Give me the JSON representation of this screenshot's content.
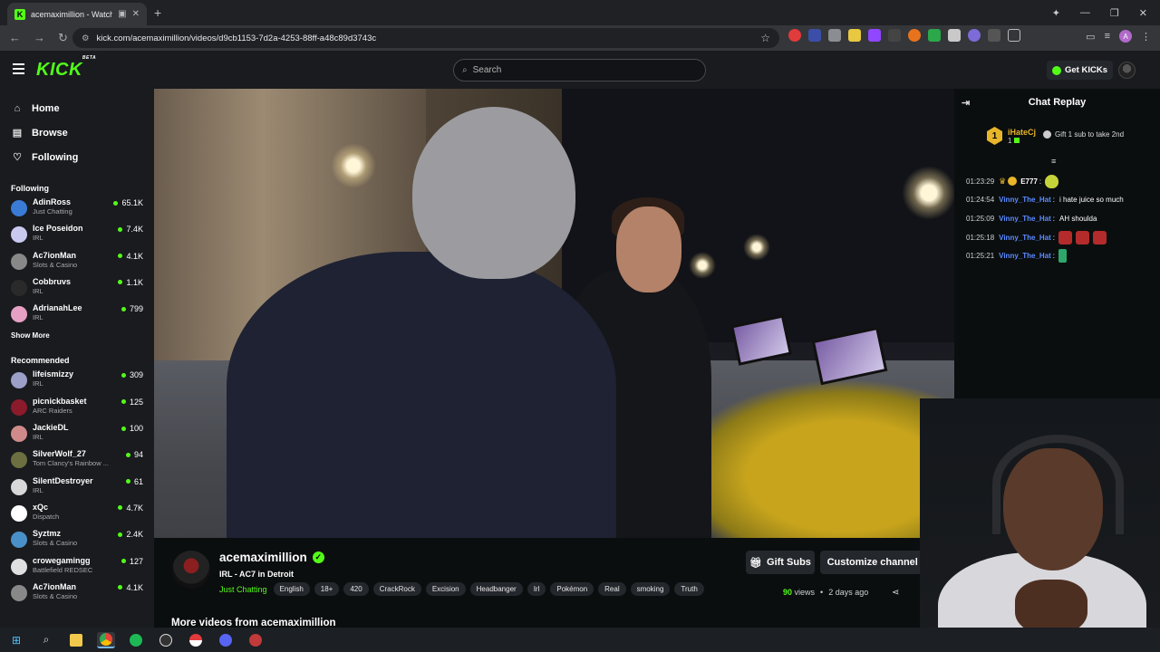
{
  "browser": {
    "tab_title": "acemaximillion - Watch the",
    "tab_favicon": "K",
    "url": "kick.com/acemaximillion/videos/d9cb1153-7d2a-4253-88ff-a48c89d3743c"
  },
  "header": {
    "logo": "KICK",
    "logo_badge": "BETA",
    "search_placeholder": "Search",
    "get_kicks": "Get KICKs"
  },
  "sidebar": {
    "nav": [
      {
        "label": "Home",
        "icon": "home-icon"
      },
      {
        "label": "Browse",
        "icon": "browse-icon"
      },
      {
        "label": "Following",
        "icon": "heart-icon"
      }
    ],
    "following_title": "Following",
    "following": [
      {
        "name": "AdinRoss",
        "category": "Just Chatting",
        "viewers": "65.1K",
        "color": "#3a7bd5"
      },
      {
        "name": "Ice Poseidon",
        "category": "IRL",
        "viewers": "7.4K",
        "color": "#c9c9f0"
      },
      {
        "name": "Ac7ionMan",
        "category": "Slots & Casino",
        "viewers": "4.1K",
        "color": "#888888"
      },
      {
        "name": "Cobbruvs",
        "category": "IRL",
        "viewers": "1.1K",
        "color": "#2a2a2a"
      },
      {
        "name": "AdrianahLee",
        "category": "IRL",
        "viewers": "799",
        "color": "#e6a0c4"
      }
    ],
    "show_more": "Show More",
    "recommended_title": "Recommended",
    "recommended": [
      {
        "name": "lifeismizzy",
        "category": "IRL",
        "viewers": "309",
        "color": "#9aa0c8"
      },
      {
        "name": "picnickbasket",
        "category": "ARC Raiders",
        "viewers": "125",
        "color": "#8b1a2b"
      },
      {
        "name": "JackieDL",
        "category": "IRL",
        "viewers": "100",
        "color": "#d08a8a"
      },
      {
        "name": "SilverWolf_27",
        "category": "Tom Clancy's Rainbow ...",
        "viewers": "94",
        "color": "#6c6f40"
      },
      {
        "name": "SilentDestroyer",
        "category": "IRL",
        "viewers": "61",
        "color": "#d8d8d8"
      },
      {
        "name": "xQc",
        "category": "Dispatch",
        "viewers": "4.7K",
        "color": "#ffffff"
      },
      {
        "name": "Syztmz",
        "category": "Slots & Casino",
        "viewers": "2.4K",
        "color": "#4a90c8"
      },
      {
        "name": "crowegamingg",
        "category": "Battlefield REDSEC",
        "viewers": "127",
        "color": "#e0e0e0"
      },
      {
        "name": "Ac7ionMan",
        "category": "Slots & Casino",
        "viewers": "4.1K",
        "color": "#888888"
      }
    ]
  },
  "video_info": {
    "channel_name": "acemaximillion",
    "title": "IRL - AC7 in Detroit",
    "category": "Just Chatting",
    "tags": [
      "English",
      "18+",
      "420",
      "CrackRock",
      "Excision",
      "Headbanger",
      "Irl",
      "Pokémon",
      "Real",
      "smoking",
      "Truth"
    ],
    "gift_subs": "Gift Subs",
    "customize": "Customize channel",
    "views_count": "90",
    "views_label": "views",
    "age": "2 days ago",
    "more_videos": "More videos from acemaximillion"
  },
  "chat": {
    "title": "Chat Replay",
    "pinned_rank": "1",
    "pinned_user": "iHateCj",
    "pinned_count": "1",
    "gift_prompt": "Gift 1 sub to take 2nd",
    "messages": [
      {
        "time": "01:23:29",
        "user": "E777",
        "text": "",
        "color": "#ffffff"
      },
      {
        "time": "01:24:54",
        "user": "Vinny_The_Hat",
        "text": "i hate juice so much",
        "color": "#5b8cff"
      },
      {
        "time": "01:25:09",
        "user": "Vinny_The_Hat",
        "text": "AH shoulda",
        "color": "#5b8cff"
      },
      {
        "time": "01:25:18",
        "user": "Vinny_The_Hat",
        "text": "",
        "color": "#5b8cff"
      },
      {
        "time": "01:25:21",
        "user": "Vinny_The_Hat",
        "text": "",
        "color": "#5b8cff"
      }
    ]
  },
  "colors": {
    "accent": "#53fc18",
    "bg": "#0b0e0f",
    "panel": "#191b1f"
  }
}
